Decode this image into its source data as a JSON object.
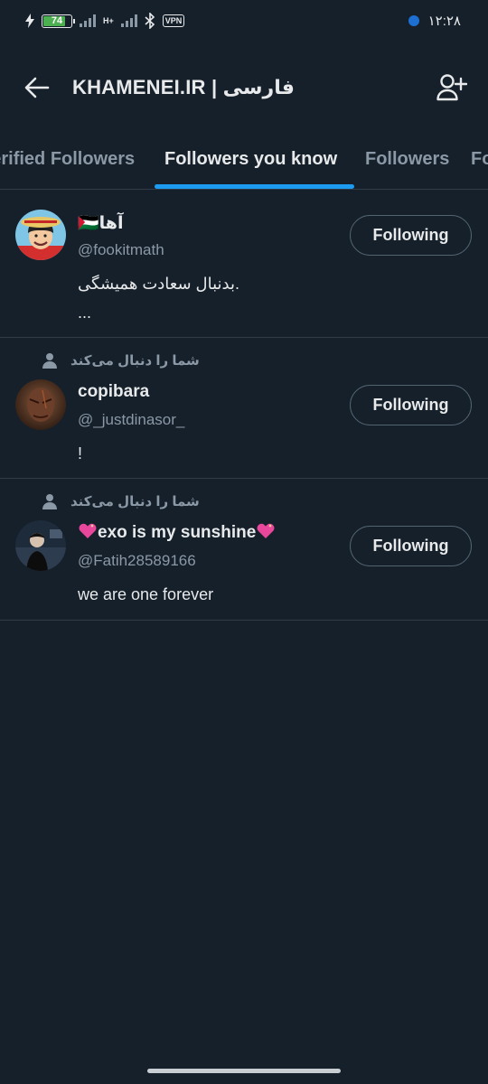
{
  "status_bar": {
    "battery": "74",
    "net_label": "H+",
    "vpn": "VPN",
    "time": "۱۲:۲۸"
  },
  "header": {
    "title": "KHAMENEI.IR | فارسی",
    "back_icon": "arrow-left-icon",
    "add_icon": "person-add-icon"
  },
  "tabs": [
    {
      "label": "Verified Followers"
    },
    {
      "label": "Followers you know",
      "active": true
    },
    {
      "label": "Followers"
    },
    {
      "label": "Following"
    }
  ],
  "users": [
    {
      "context": "",
      "name": "🇵🇸آها",
      "handle": "@fookitmath",
      "bio_line1": "بدنبال سعادت همیشگی.",
      "bio_line2": "...",
      "button": "Following"
    },
    {
      "context": "شما را دنبال می‌کند",
      "name": "copibara",
      "handle": "@_justdinasor_",
      "bio_line1": "!",
      "button": "Following"
    },
    {
      "context": "شما را دنبال می‌کند",
      "name": "exo is my sunshine",
      "handle": "@Fatih28589166",
      "bio_line1": "we are one forever",
      "button": "Following"
    }
  ],
  "colors": {
    "background": "#15202b",
    "accent": "#1d9bf0",
    "secondary_text": "#8b98a5"
  }
}
